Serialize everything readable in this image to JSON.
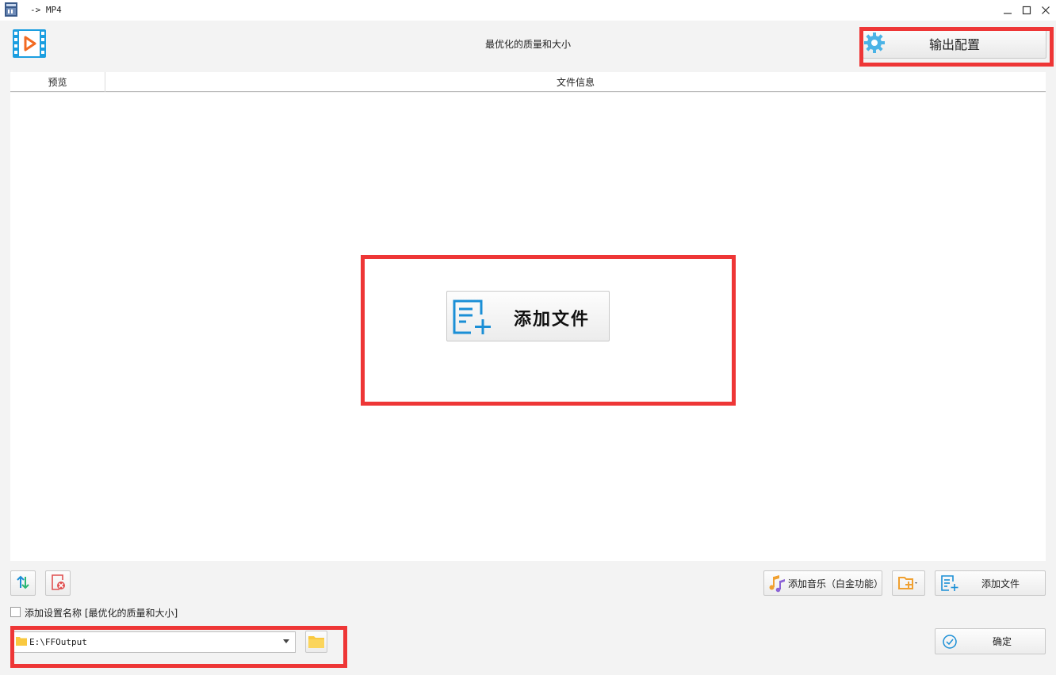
{
  "window": {
    "title": "-> MP4",
    "minimize_icon": "minimize-icon",
    "maximize_icon": "maximize-icon",
    "close_icon": "close-icon"
  },
  "header": {
    "title": "最优化的质量和大小",
    "output_config_label": "输出配置",
    "logo_icon": "video-file-icon"
  },
  "list": {
    "columns": [
      "预览",
      "文件信息"
    ],
    "center_add_label": "添加文件"
  },
  "toolbar": {
    "add_music_label": "添加音乐（白金功能）",
    "add_file_label": "添加文件",
    "add_folder_icon": "add-folder-icon",
    "sort_icon": "sort-icon",
    "clear_icon": "clear-list-icon"
  },
  "options": {
    "append_setting_name_label": "添加设置名称 [最优化的质量和大小]",
    "append_setting_name_checked": false
  },
  "output": {
    "path": "E:\\FFOutput"
  },
  "actions": {
    "ok_label": "确定"
  },
  "colors": {
    "accent_blue": "#1b8fd6",
    "highlight_red": "#ee3636",
    "folder_yellow": "#f9c940",
    "gear_blue": "#4bb3e6"
  }
}
